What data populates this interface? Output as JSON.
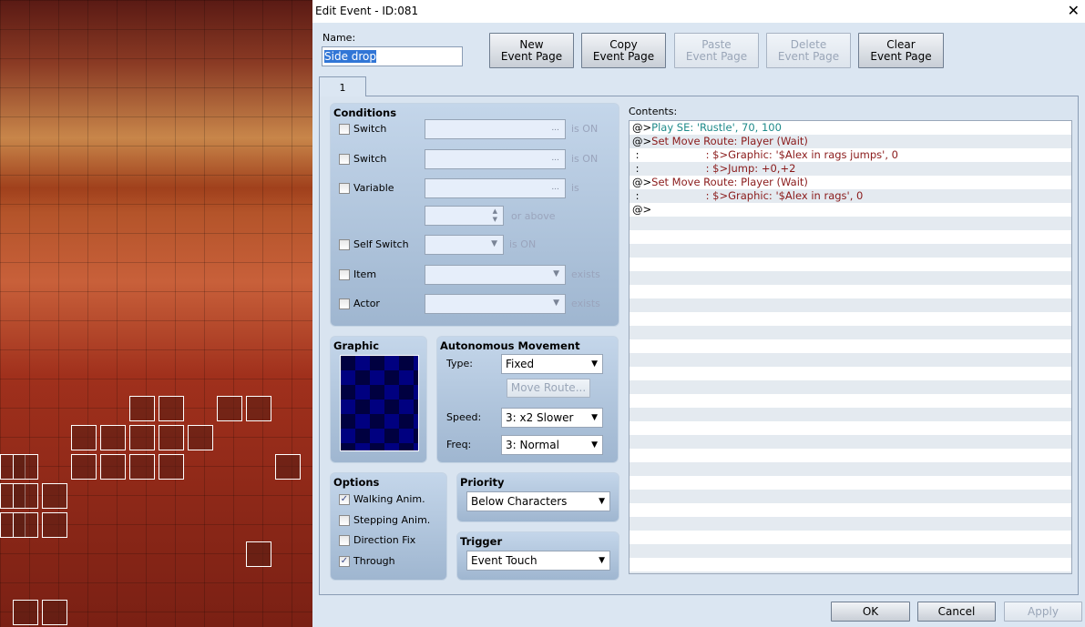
{
  "window": {
    "title": "Edit Event - ID:081",
    "close_icon": "close-icon"
  },
  "name": {
    "label": "Name:",
    "value": "Side drop"
  },
  "toolbar": {
    "new": "New\nEvent Page",
    "copy": "Copy\nEvent Page",
    "paste": "Paste\nEvent Page",
    "delete": "Delete\nEvent Page",
    "clear": "Clear\nEvent Page"
  },
  "tabs": [
    {
      "label": "1"
    }
  ],
  "conditions": {
    "title": "Conditions",
    "switch1": {
      "label": "Switch",
      "suffix": "is ON",
      "checked": false
    },
    "switch2": {
      "label": "Switch",
      "suffix": "is ON",
      "checked": false
    },
    "variable": {
      "label": "Variable",
      "suffix": "is",
      "suffix2": "or above",
      "checked": false
    },
    "self_switch": {
      "label": "Self Switch",
      "suffix": "is ON",
      "checked": false
    },
    "item": {
      "label": "Item",
      "suffix": "exists",
      "checked": false
    },
    "actor": {
      "label": "Actor",
      "suffix": "exists",
      "checked": false
    },
    "ellipsis": "..."
  },
  "graphic": {
    "title": "Graphic"
  },
  "movement": {
    "title": "Autonomous Movement",
    "type_label": "Type:",
    "type": "Fixed",
    "move_route": "Move Route...",
    "speed_label": "Speed:",
    "speed": "3: x2 Slower",
    "freq_label": "Freq:",
    "freq": "3: Normal"
  },
  "options": {
    "title": "Options",
    "items": [
      {
        "label": "Walking Anim.",
        "checked": true
      },
      {
        "label": "Stepping Anim.",
        "checked": false
      },
      {
        "label": "Direction Fix",
        "checked": false
      },
      {
        "label": "Through",
        "checked": true
      }
    ]
  },
  "priority": {
    "title": "Priority",
    "value": "Below Characters"
  },
  "trigger": {
    "title": "Trigger",
    "value": "Event Touch"
  },
  "contents": {
    "label": "Contents:",
    "lines": [
      {
        "prefix": "@>",
        "text": "Play SE: 'Rustle', 70, 100",
        "color": "#1e8a8a"
      },
      {
        "prefix": "@>",
        "text": "Set Move Route: Player (Wait)",
        "color": "#8a1a1a"
      },
      {
        "prefix": " :",
        "text": "                    : $>Graphic: '$Alex in rags jumps', 0",
        "color": "#8a1a1a"
      },
      {
        "prefix": " :",
        "text": "                    : $>Jump: +0,+2",
        "color": "#8a1a1a"
      },
      {
        "prefix": "@>",
        "text": "Set Move Route: Player (Wait)",
        "color": "#8a1a1a"
      },
      {
        "prefix": " :",
        "text": "                    : $>Graphic: '$Alex in rags', 0",
        "color": "#8a1a1a"
      },
      {
        "prefix": "@>",
        "text": "",
        "color": "#000000"
      }
    ]
  },
  "footer": {
    "ok": "OK",
    "cancel": "Cancel",
    "apply": "Apply"
  }
}
